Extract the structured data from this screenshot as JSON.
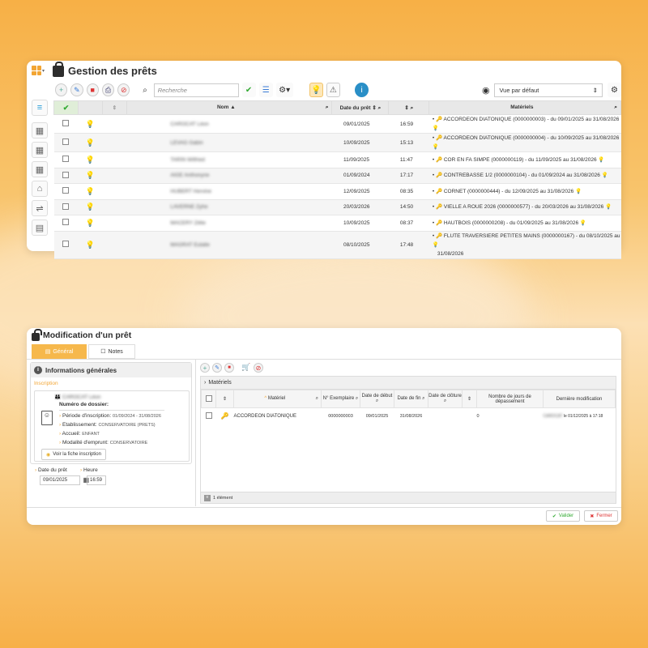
{
  "loans": {
    "title": "Gestion des prêts",
    "search_placeholder": "Recherche",
    "view_select": "Vue par défaut",
    "headers": {
      "nom": "Nom",
      "date": "Date du prêt",
      "materiels": "Matériels"
    },
    "rows": [
      {
        "name": "CAROCAT Léon",
        "date": "09/01/2025",
        "time": "16:59",
        "material": "ACCORDEON DIATONIQUE (0000000003) - du 09/01/2025 au 31/08/2026"
      },
      {
        "name": "LEVAG Gabin",
        "date": "10/09/2025",
        "time": "15:13",
        "material": "ACCORDEON DIATONIQUE (0000000004) - du 10/09/2025 au 31/08/2026"
      },
      {
        "name": "TARIN Wilfried",
        "date": "11/09/2025",
        "time": "11:47",
        "material": "COR EN FA SIMPE (0000000119) - du 11/09/2025 au 31/08/2026"
      },
      {
        "name": "AIGE Anthonyne",
        "date": "01/09/2024",
        "time": "17:17",
        "material": "CONTREBASSE 1/2 (0000000104) - du 01/09/2024 au 31/08/2026"
      },
      {
        "name": "HUBERT Hervine",
        "date": "12/09/2025",
        "time": "08:35",
        "material": "CORNET (0000000444) - du 12/09/2025 au 31/08/2026"
      },
      {
        "name": "LAVERNE Zyhe",
        "date": "20/03/2026",
        "time": "14:50",
        "material": "VIELLE A ROUE 2026 (0000000577) - du 20/03/2026 au 31/08/2026"
      },
      {
        "name": "MACERY Zélie",
        "date": "10/09/2025",
        "time": "08:37",
        "material": "HAUTBOIS (0000000208) - du 01/09/2025 au 31/08/2026"
      },
      {
        "name": "MAGRAT Eulalie",
        "date": "08/10/2025",
        "time": "17:48",
        "material": "FLUTE TRAVERSIERE PETITES MAINS (0000000167) - du 08/10/2025 au",
        "material2": "31/08/2026"
      }
    ]
  },
  "edit": {
    "title": "Modification d'un prêt",
    "tabs": [
      "Général",
      "Notes"
    ],
    "info_title": "Informations générales",
    "inscription_label": "Inscription",
    "person": "CAROCAT Léon",
    "dossier_label": "Numéro de dossier:",
    "periode_label": "Période d'inscription:",
    "periode": "01/09/2024 - 31/08/2026",
    "etab_label": "Etablissement:",
    "etab": "CONSERVATOIRE (PRETS)",
    "accueil_label": "Accueil:",
    "accueil": "ENFANT",
    "modalite_label": "Modalité d'emprunt:",
    "modalite": "CONSERVATOIRE",
    "fiche_btn": "Voir la fiche inscription",
    "date_label": "Date du prêt",
    "date": "09/01/2025",
    "heure_label": "Heure",
    "heure": "16:59",
    "materiels_title": "Matériels",
    "cols": [
      "Matériel",
      "N° Exemplaire",
      "Date de début",
      "Date de fin",
      "Date de clôture",
      "Nombre de jours de dépassement",
      "Dernière modification"
    ],
    "row": {
      "materiel": "ACCORDEON DIATONIQUE",
      "exemplaire": "0000000003",
      "debut": "09/01/2025",
      "fin": "31/08/2026",
      "jours": "0",
      "modif_user": "CAROCAT",
      "modif": "le 01/12/2025 à 17:18"
    },
    "count": "1 élément",
    "valider": "Valider",
    "fermer": "Fermer"
  },
  "colors": {
    "accent": "#f6b84c",
    "brand": "#f2a533"
  }
}
